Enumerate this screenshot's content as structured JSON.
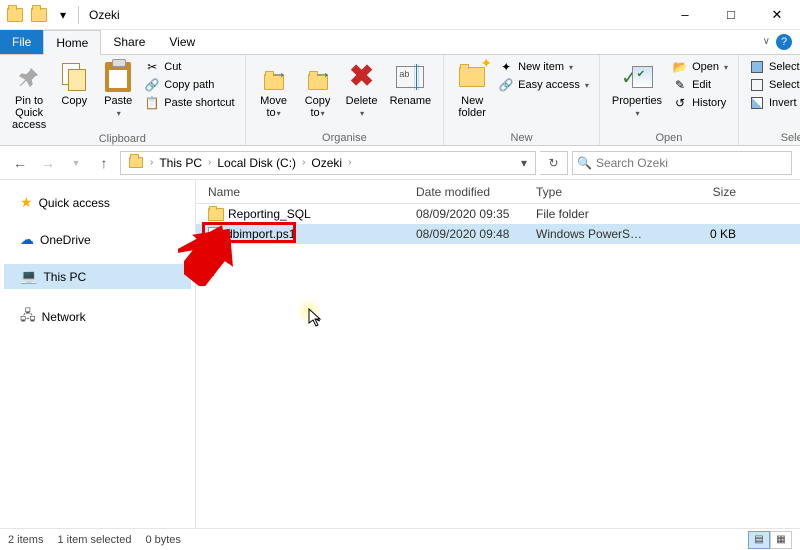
{
  "title": "Ozeki",
  "qat": {
    "down": "▾"
  },
  "tabs": {
    "file": "File",
    "home": "Home",
    "share": "Share",
    "view": "View"
  },
  "ribbon": {
    "clipboard": {
      "pin": "Pin to Quick\naccess",
      "copy": "Copy",
      "paste": "Paste",
      "cut": "Cut",
      "copy_path": "Copy path",
      "paste_shortcut": "Paste shortcut",
      "label": "Clipboard"
    },
    "organise": {
      "move": "Move\nto",
      "copy": "Copy\nto",
      "delete": "Delete",
      "rename": "Rename",
      "label": "Organise"
    },
    "new": {
      "folder": "New\nfolder",
      "item": "New item",
      "easy": "Easy access",
      "label": "New"
    },
    "open": {
      "properties": "Properties",
      "open": "Open",
      "edit": "Edit",
      "history": "History",
      "label": "Open"
    },
    "select": {
      "all": "Select all",
      "none": "Select none",
      "invert": "Invert selection",
      "label": "Select"
    }
  },
  "breadcrumbs": [
    "This PC",
    "Local Disk (C:)",
    "Ozeki"
  ],
  "search": {
    "placeholder": "Search Ozeki"
  },
  "sidebar": {
    "quick": "Quick access",
    "onedrive": "OneDrive",
    "thispc": "This PC",
    "network": "Network"
  },
  "columns": {
    "name": "Name",
    "date": "Date modified",
    "type": "Type",
    "size": "Size"
  },
  "rows": [
    {
      "name": "Reporting_SQL",
      "date": "08/09/2020 09:35",
      "type": "File folder",
      "size": "",
      "icon": "folder",
      "selected": false
    },
    {
      "name": "dbimport.ps1",
      "date": "08/09/2020 09:48",
      "type": "Windows PowerS…",
      "size": "0 KB",
      "icon": "ps1",
      "selected": true
    }
  ],
  "status": {
    "items": "2 items",
    "selected": "1 item selected",
    "bytes": "0 bytes"
  }
}
